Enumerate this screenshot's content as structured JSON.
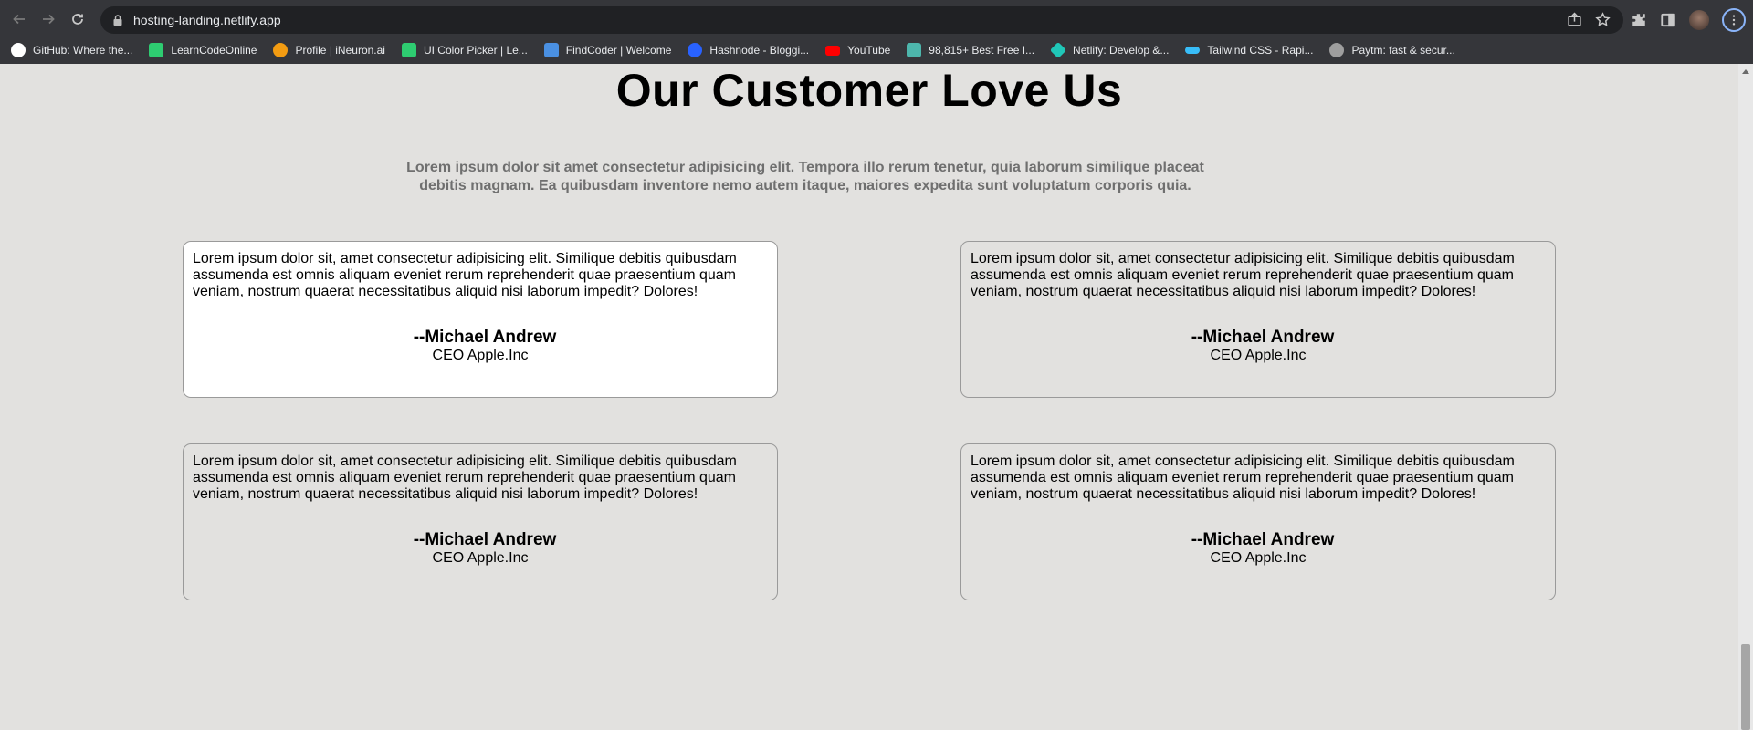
{
  "browser": {
    "url": "hosting-landing.netlify.app",
    "bookmarks": [
      {
        "label": "GitHub: Where the...",
        "icon": "github-icon",
        "color": "#ffffff"
      },
      {
        "label": "LearnCodeOnline",
        "icon": "learncodeonline-icon",
        "color": "#2ecc71"
      },
      {
        "label": "Profile | iNeuron.ai",
        "icon": "ineuron-icon",
        "color": "#f39c12"
      },
      {
        "label": "UI Color Picker | Le...",
        "icon": "learncodeonline-icon",
        "color": "#2ecc71"
      },
      {
        "label": "FindCoder | Welcome",
        "icon": "code-icon",
        "color": "#4a90e2"
      },
      {
        "label": "Hashnode - Bloggi...",
        "icon": "hashnode-icon",
        "color": "#2962ff"
      },
      {
        "label": "YouTube",
        "icon": "youtube-icon",
        "color": "#ff0000"
      },
      {
        "label": "98,815+ Best Free I...",
        "icon": "freepik-icon",
        "color": "#4db6ac"
      },
      {
        "label": "Netlify: Develop &...",
        "icon": "netlify-icon",
        "color": "#20c6b7"
      },
      {
        "label": "Tailwind CSS - Rapi...",
        "icon": "tailwind-icon",
        "color": "#38bdf8"
      },
      {
        "label": "Paytm: fast & secur...",
        "icon": "globe-icon",
        "color": "#9e9e9e"
      }
    ]
  },
  "section": {
    "title": "Our Customer Love Us",
    "subtitle": "Lorem ipsum dolor sit amet consectetur adipisicing elit. Tempora illo rerum tenetur, quia laborum similique placeat debitis magnam. Ea quibusdam inventore nemo autem itaque, maiores expedita sunt voluptatum corporis quia."
  },
  "testimonials": [
    {
      "text": "Lorem ipsum dolor sit, amet consectetur adipisicing elit. Similique debitis quibusdam assumenda est omnis aliquam eveniet rerum reprehenderit quae praesentium quam veniam, nostrum quaerat necessitatibus aliquid nisi laborum impedit? Dolores!",
      "name": "--Michael Andrew",
      "role": "CEO Apple.Inc"
    },
    {
      "text": "Lorem ipsum dolor sit, amet consectetur adipisicing elit. Similique debitis quibusdam assumenda est omnis aliquam eveniet rerum reprehenderit quae praesentium quam veniam, nostrum quaerat necessitatibus aliquid nisi laborum impedit? Dolores!",
      "name": "--Michael Andrew",
      "role": "CEO Apple.Inc"
    },
    {
      "text": "Lorem ipsum dolor sit, amet consectetur adipisicing elit. Similique debitis quibusdam assumenda est omnis aliquam eveniet rerum reprehenderit quae praesentium quam veniam, nostrum quaerat necessitatibus aliquid nisi laborum impedit? Dolores!",
      "name": "--Michael Andrew",
      "role": "CEO Apple.Inc"
    },
    {
      "text": "Lorem ipsum dolor sit, amet consectetur adipisicing elit. Similique debitis quibusdam assumenda est omnis aliquam eveniet rerum reprehenderit quae praesentium quam veniam, nostrum quaerat necessitatibus aliquid nisi laborum impedit? Dolores!",
      "name": "--Michael Andrew",
      "role": "CEO Apple.Inc"
    }
  ],
  "colors": {
    "page_background": "#e2e1df",
    "chrome_background": "#35363a",
    "active_card": "#ffffff"
  }
}
